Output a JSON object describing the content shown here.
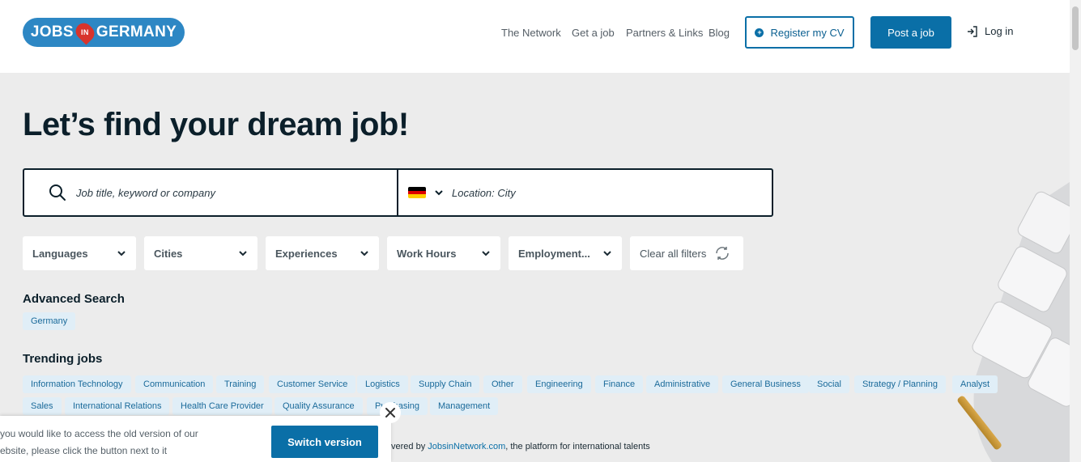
{
  "header": {
    "logo": {
      "part1": "JOBS",
      "part2": "IN",
      "part3": "GERMANY"
    },
    "nav": [
      {
        "label": "The Network"
      },
      {
        "label": "Get a job"
      },
      {
        "label": "Partners & Links"
      },
      {
        "label": "Blog"
      }
    ],
    "register_label": "Register my CV",
    "post_label": "Post a job",
    "login_label": "Log in"
  },
  "hero": {
    "title": "Let’s find your dream job!"
  },
  "search": {
    "keyword_placeholder": "Job title, keyword or company",
    "location_placeholder": "Location: City",
    "country_flag_colors": [
      "#000000",
      "#dd0000",
      "#ffce00"
    ]
  },
  "filters": [
    {
      "label": "Languages"
    },
    {
      "label": "Cities"
    },
    {
      "label": "Experiences"
    },
    {
      "label": "Work Hours"
    },
    {
      "label": "Employment..."
    }
  ],
  "clear_filters_label": "Clear all filters",
  "advanced_search": {
    "title": "Advanced Search",
    "chip": "Germany"
  },
  "trending": {
    "title": "Trending jobs",
    "row1": [
      "Information Technology",
      "Communication",
      "Training",
      "Customer Service",
      "Logistics",
      "Supply Chain",
      "Other",
      "Engineering",
      "Finance",
      "Administrative",
      "General Business",
      "Social",
      "Strategy / Planning",
      "Analyst"
    ],
    "row2": [
      "Sales",
      "International Relations",
      "Health Care Provider",
      "Quality Assurance",
      "Purchasing",
      "Management"
    ]
  },
  "popup": {
    "line1": "you would like to access the old version of our",
    "line2": "ebsite, please click the button next to it",
    "switch_label": "Switch version"
  },
  "powered": {
    "prefix": "vered by ",
    "link": "JobsinNetwork.com",
    "suffix": ", the platform for international talents"
  },
  "colors": {
    "brand": "#0a6fa7",
    "logo": "#2d87c4",
    "pin": "#d8342c",
    "chip_bg": "#e0eef7"
  }
}
